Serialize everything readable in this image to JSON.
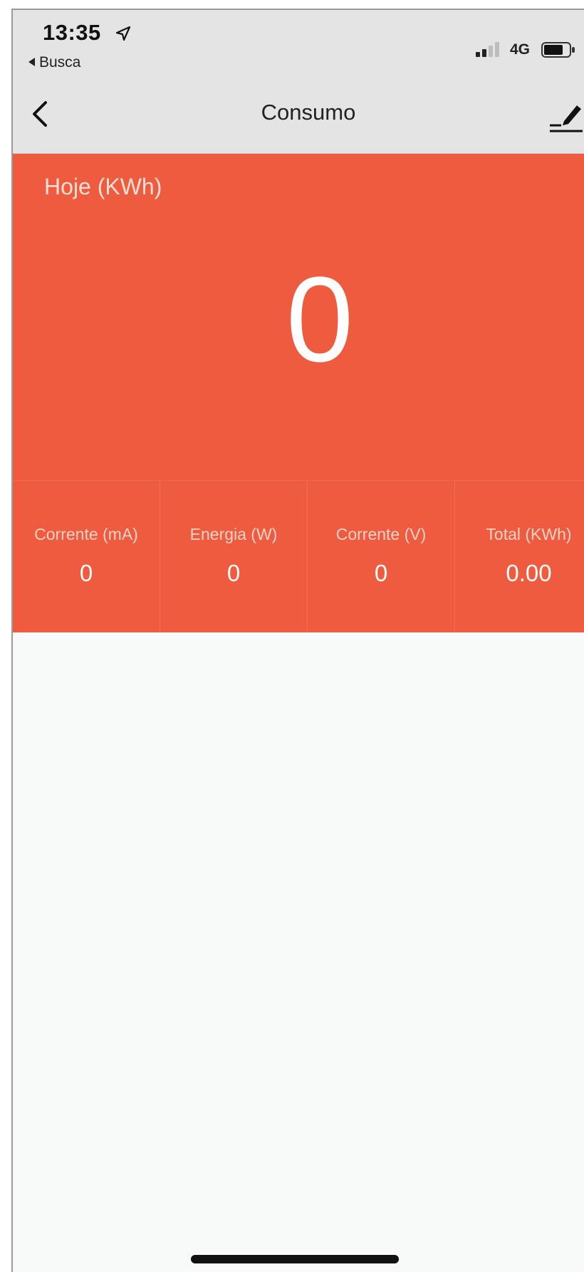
{
  "status_bar": {
    "time": "13:35",
    "back_app_label": "Busca",
    "network": "4G",
    "icons": [
      "location-arrow-icon",
      "cellular-signal-icon",
      "battery-icon"
    ]
  },
  "nav": {
    "title": "Consumo",
    "back_icon": "chevron-left-icon",
    "edit_icon": "edit-pencil-icon"
  },
  "hero": {
    "label": "Hoje (KWh)",
    "value": "0"
  },
  "stats": [
    {
      "label": "Corrente (mA)",
      "value": "0"
    },
    {
      "label": "Energia (W)",
      "value": "0"
    },
    {
      "label": "Corrente (V)",
      "value": "0"
    },
    {
      "label": "Total (KWh)",
      "value": "0.00"
    }
  ],
  "colors": {
    "accent": "#ef5b3e",
    "bar_background": "#e4e4e4",
    "page_background": "#f8f9f9"
  }
}
